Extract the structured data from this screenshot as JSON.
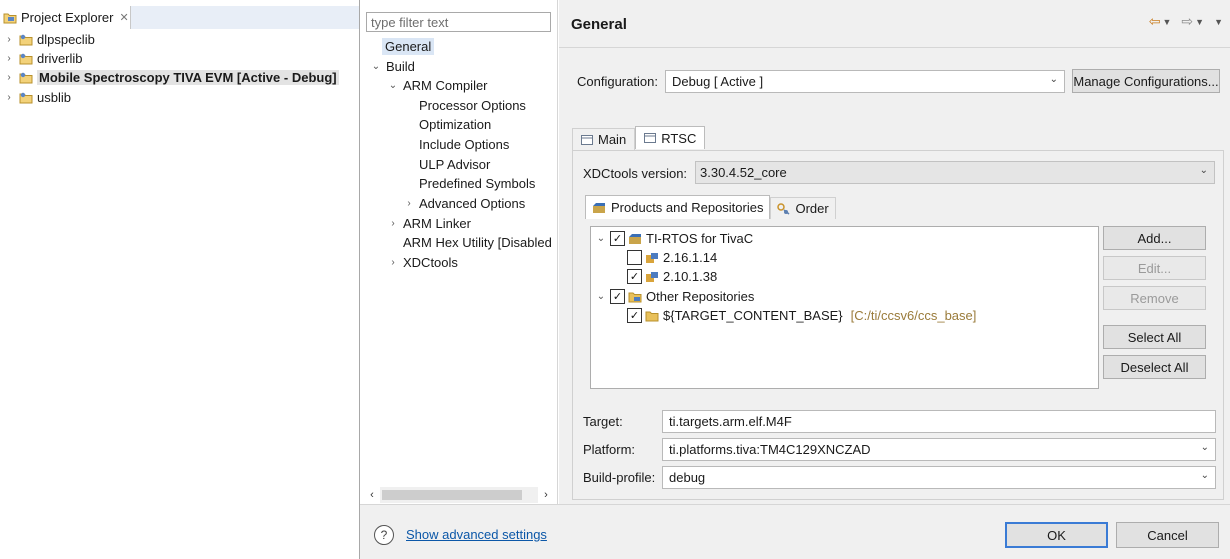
{
  "project_explorer": {
    "tab_label": "Project Explorer",
    "items": [
      {
        "label": "dlpspeclib",
        "active": false
      },
      {
        "label": "driverlib",
        "active": false
      },
      {
        "label": "Mobile Spectroscopy TIVA EVM  [Active - Debug]",
        "active": true
      },
      {
        "label": "usblib",
        "active": false
      }
    ]
  },
  "nav": {
    "filter_placeholder": "type filter text",
    "items": [
      {
        "label": "General",
        "twisty": ""
      },
      {
        "label": "Build",
        "twisty": "⌄"
      },
      {
        "label": "ARM Compiler",
        "twisty": "⌄"
      },
      {
        "label": "Processor Options",
        "twisty": ""
      },
      {
        "label": "Optimization",
        "twisty": ""
      },
      {
        "label": "Include Options",
        "twisty": ""
      },
      {
        "label": "ULP Advisor",
        "twisty": ""
      },
      {
        "label": "Predefined Symbols",
        "twisty": ""
      },
      {
        "label": "Advanced Options",
        "twisty": "›"
      },
      {
        "label": "ARM Linker",
        "twisty": "›"
      },
      {
        "label": "ARM Hex Utility  [Disabled",
        "twisty": ""
      },
      {
        "label": "XDCtools",
        "twisty": "›"
      }
    ]
  },
  "header": {
    "title": "General"
  },
  "config": {
    "label": "Configuration:",
    "value": "Debug  [ Active ]",
    "manage_label": "Manage Configurations..."
  },
  "tabs": {
    "main": "Main",
    "rtsc": "RTSC"
  },
  "rtsc": {
    "xdc_label": "XDCtools version:",
    "xdc_value": "3.30.4.52_core",
    "subtab_products": "Products and Repositories",
    "subtab_order": "Order",
    "tree": {
      "tirtos": "TI-RTOS for TivaC",
      "v1": "2.16.1.14",
      "v2": "2.10.1.38",
      "other": "Other Repositories",
      "target_base": "${TARGET_CONTENT_BASE}",
      "target_base_path": "[C:/ti/ccsv6/ccs_base]"
    },
    "buttons": {
      "add": "Add...",
      "edit": "Edit...",
      "remove": "Remove",
      "select_all": "Select All",
      "deselect_all": "Deselect All"
    },
    "target_label": "Target:",
    "target_value": "ti.targets.arm.elf.M4F",
    "platform_label": "Platform:",
    "platform_value": "ti.platforms.tiva:TM4C129XNCZAD",
    "profile_label": "Build-profile:",
    "profile_value": "debug"
  },
  "footer": {
    "help_glyph": "?",
    "advanced_link": "Show advanced settings",
    "ok": "OK",
    "cancel": "Cancel"
  },
  "colors": {
    "accent": "#3a7bd5",
    "link": "#0b57a8",
    "selection": "#dae6f5"
  }
}
